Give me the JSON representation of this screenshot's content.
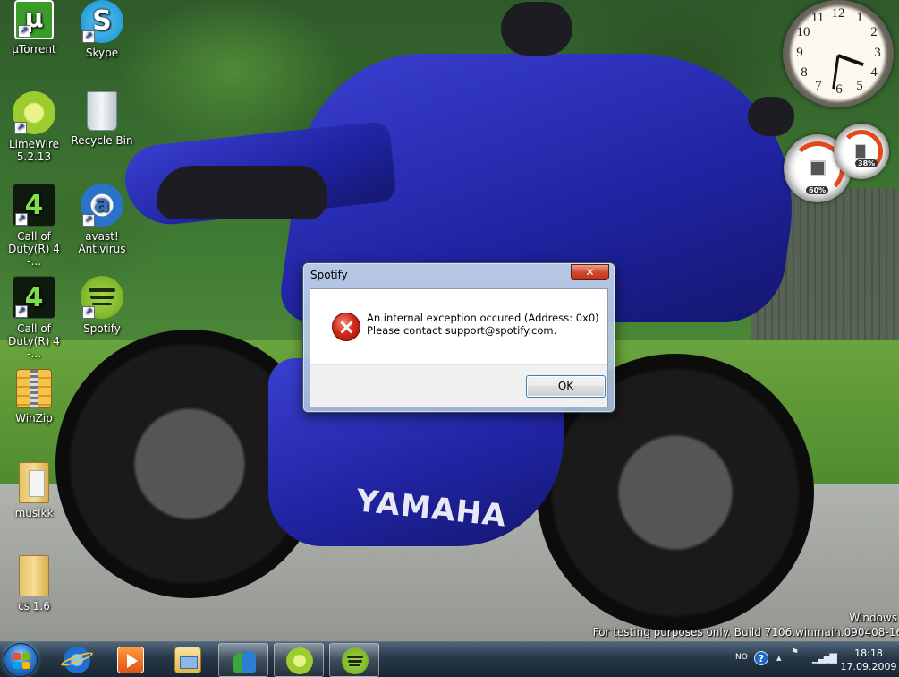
{
  "desktop": {
    "icons": [
      {
        "label": "µTorrent",
        "icon": "utorrent-icon"
      },
      {
        "label": "Skype",
        "icon": "skype-icon"
      },
      {
        "label": "LimeWire\n5.2.13",
        "icon": "limewire-icon"
      },
      {
        "label": "Recycle Bin",
        "icon": "recycle-bin-icon"
      },
      {
        "label": "Call of\nDuty(R) 4 -...",
        "icon": "call-of-duty-icon"
      },
      {
        "label": "avast!\nAntivirus",
        "icon": "avast-icon"
      },
      {
        "label": "Call of\nDuty(R) 4 -...",
        "icon": "call-of-duty-icon"
      },
      {
        "label": "Spotify",
        "icon": "spotify-icon"
      },
      {
        "label": "WinZip",
        "icon": "winzip-icon"
      },
      {
        "label": "musikk",
        "icon": "folder-icon"
      },
      {
        "label": "cs 1.6",
        "icon": "folder-icon"
      }
    ],
    "wallpaper_text": "YAMAHA"
  },
  "gadgets": {
    "clock_numbers": [
      "12",
      "1",
      "2",
      "3",
      "4",
      "5",
      "6",
      "7",
      "8",
      "9",
      "10",
      "11"
    ],
    "cpu_percent": "60%",
    "memory_percent": "38%"
  },
  "dialog": {
    "title": "Spotify",
    "close_label": "✕",
    "message_line1": "An internal exception occured (Address: 0x0)",
    "message_line2": "Please contact support@spotify.com.",
    "ok_label": "OK",
    "icon": "error-icon"
  },
  "watermark": {
    "line1": "Windows",
    "line2": "For testing purposes only. Build 7106.winmain.090408-16"
  },
  "taskbar": {
    "pinned": [
      {
        "name": "internet-explorer-icon",
        "active": false
      },
      {
        "name": "media-player-icon",
        "active": false
      },
      {
        "name": "file-explorer-icon",
        "active": false
      },
      {
        "name": "messenger-icon",
        "active": true
      },
      {
        "name": "limewire-icon",
        "active": true
      },
      {
        "name": "spotify-icon",
        "active": true
      }
    ],
    "tray": {
      "language": "NO",
      "help": "?",
      "time": "18:18",
      "date": "17.09.2009"
    }
  },
  "colors": {
    "taskbar": "#1e3042",
    "error_red": "#d32a1a",
    "bike_blue": "#2a2fc0"
  }
}
